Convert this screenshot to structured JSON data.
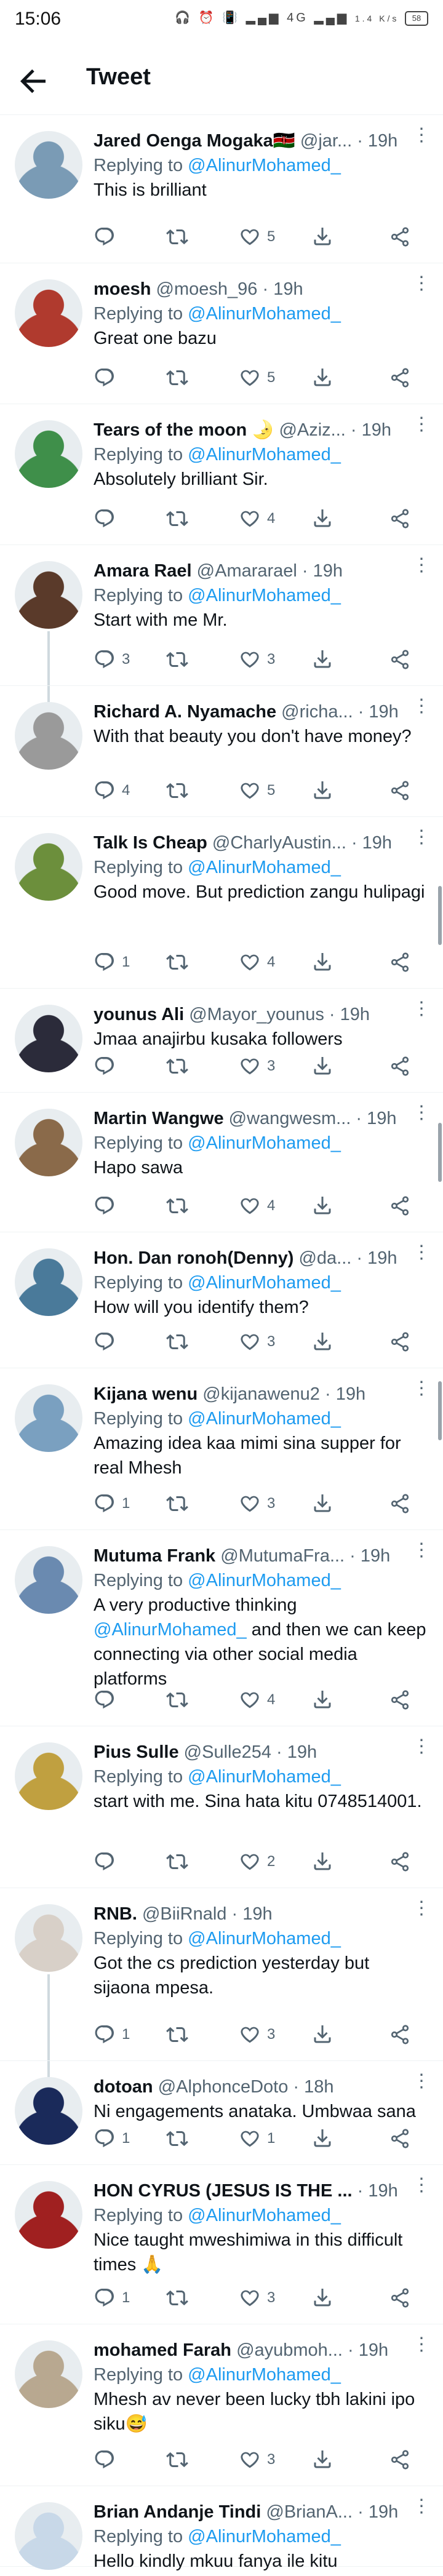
{
  "status_bar": {
    "time": "15:06",
    "icons": "🎧 ⏰ 📳 ▂▄▆ 4G ▂▄▆",
    "speed": "1.4 K/s",
    "battery": "58"
  },
  "header": {
    "title": "Tweet"
  },
  "tweets": [
    {
      "name": "Jared Oenga Mogaka🇰🇪",
      "handle": "@jar...",
      "time": "19h",
      "replying_label": "Replying to",
      "replying_to": "@AlinurMohamed_",
      "text": "This is brilliant",
      "mention": "",
      "text_after": "",
      "replies": "",
      "retweets": "",
      "likes": "5",
      "avatar": "#7a9bb5"
    },
    {
      "name": "moesh",
      "handle": "@moesh_96",
      "time": "19h",
      "replying_label": "Replying to",
      "replying_to": "@AlinurMohamed_",
      "text": "Great one bazu",
      "mention": "",
      "text_after": "",
      "replies": "",
      "retweets": "",
      "likes": "5",
      "avatar": "#b03a2e"
    },
    {
      "name": "Tears of the moon 🌛",
      "handle": "@Aziz...",
      "time": "19h",
      "replying_label": "Replying to",
      "replying_to": "@AlinurMohamed_",
      "text": "Absolutely brilliant Sir.",
      "mention": "",
      "text_after": "",
      "replies": "",
      "retweets": "",
      "likes": "4",
      "avatar": "#3f8f4a"
    },
    {
      "name": "Amara Rael",
      "handle": "@Amararael",
      "time": "19h",
      "replying_label": "Replying to",
      "replying_to": "@AlinurMohamed_",
      "text": "Start with me Mr.",
      "mention": "",
      "text_after": "",
      "replies": "3",
      "retweets": "",
      "likes": "3",
      "avatar": "#5a3a2a"
    },
    {
      "name": "Richard A. Nyamache",
      "handle": "@richa...",
      "time": "19h",
      "replying_label": "",
      "replying_to": "",
      "text": "With that beauty you don't have money?",
      "mention": "",
      "text_after": "",
      "replies": "4",
      "retweets": "",
      "likes": "5",
      "avatar": "#9a9a9a"
    },
    {
      "name": "Talk Is Cheap",
      "handle": "@CharlyAustin...",
      "time": "19h",
      "replying_label": "Replying to",
      "replying_to": "@AlinurMohamed_",
      "text": "Good move. But prediction zangu hulipagi",
      "mention": "",
      "text_after": "",
      "replies": "1",
      "retweets": "",
      "likes": "4",
      "avatar": "#6c8f3c"
    },
    {
      "name": "younus Ali",
      "handle": "@Mayor_younus",
      "time": "19h",
      "replying_label": "",
      "replying_to": "",
      "text": "Jmaa anajirbu kusaka followers",
      "mention": "",
      "text_after": "",
      "replies": "",
      "retweets": "",
      "likes": "3",
      "avatar": "#2b2b3a"
    },
    {
      "name": "Martin Wangwe",
      "handle": "@wangwesm...",
      "time": "19h",
      "replying_label": "Replying to",
      "replying_to": "@AlinurMohamed_",
      "text": "Hapo sawa",
      "mention": "",
      "text_after": "",
      "replies": "",
      "retweets": "",
      "likes": "4",
      "avatar": "#8a6a4a"
    },
    {
      "name": "Hon. Dan ronoh(Denny)",
      "handle": "@da...",
      "time": "19h",
      "replying_label": "Replying to",
      "replying_to": "@AlinurMohamed_",
      "text": "How will you identify them?",
      "mention": "",
      "text_after": "",
      "replies": "",
      "retweets": "",
      "likes": "3",
      "avatar": "#4a7a9a"
    },
    {
      "name": "Kijana wenu",
      "handle": "@kijanawenu2",
      "time": "19h",
      "replying_label": "Replying to",
      "replying_to": "@AlinurMohamed_",
      "text": "Amazing idea kaa mimi sina supper for real Mhesh",
      "mention": "",
      "text_after": "",
      "replies": "1",
      "retweets": "",
      "likes": "3",
      "avatar": "#7aa0c0"
    },
    {
      "name": "Mutuma Frank",
      "handle": "@MutumaFra...",
      "time": "19h",
      "replying_label": "Replying to",
      "replying_to": "@AlinurMohamed_",
      "text": "A very productive thinking ",
      "mention": "@AlinurMohamed_",
      "text_after": " and then we can keep connecting via other social media platforms",
      "replies": "",
      "retweets": "",
      "likes": "4",
      "avatar": "#6a8ab0"
    },
    {
      "name": "Pius Sulle",
      "handle": "@Sulle254",
      "time": "19h",
      "replying_label": "Replying to",
      "replying_to": "@AlinurMohamed_",
      "text": "start with me. Sina hata kitu 0748514001.",
      "mention": "",
      "text_after": "",
      "replies": "",
      "retweets": "",
      "likes": "2",
      "avatar": "#c0a040"
    },
    {
      "name": "RNB.",
      "handle": "@BiiRnald",
      "time": "19h",
      "replying_label": "Replying to",
      "replying_to": "@AlinurMohamed_",
      "text": "Got the cs prediction yesterday but sijaona mpesa.",
      "mention": "",
      "text_after": "",
      "replies": "1",
      "retweets": "",
      "likes": "3",
      "avatar": "#d8d0c8"
    },
    {
      "name": "dotoan",
      "handle": "@AlphonceDoto",
      "time": "18h",
      "replying_label": "",
      "replying_to": "",
      "text": "Ni engagements anataka. Umbwaa sana",
      "mention": "",
      "text_after": "",
      "replies": "1",
      "retweets": "",
      "likes": "1",
      "avatar": "#1a2a5a"
    },
    {
      "name": "HON CYRUS (JESUS IS THE ...",
      "handle": "",
      "time": "19h",
      "replying_label": "Replying to",
      "replying_to": "@AlinurMohamed_",
      "text": "Nice taught mweshimiwa in this difficult times 🙏",
      "mention": "",
      "text_after": "",
      "replies": "1",
      "retweets": "",
      "likes": "3",
      "avatar": "#a02020"
    },
    {
      "name": "mohamed Farah",
      "handle": "@ayubmoh...",
      "time": "19h",
      "replying_label": "Replying to",
      "replying_to": "@AlinurMohamed_",
      "text": "Mhesh av never been lucky tbh lakini ipo siku😅",
      "mention": "",
      "text_after": "",
      "replies": "",
      "retweets": "",
      "likes": "3",
      "avatar": "#b8a890"
    },
    {
      "name": "Brian Andanje Tindi",
      "handle": "@BrianA...",
      "time": "19h",
      "replying_label": "Replying to",
      "replying_to": "@AlinurMohamed_",
      "text": "Hello kindly mkuu fanya ile kitu",
      "mention": "",
      "text_after": "",
      "replies": "",
      "retweets": "",
      "likes": "",
      "avatar": "#c8d8e8"
    }
  ]
}
